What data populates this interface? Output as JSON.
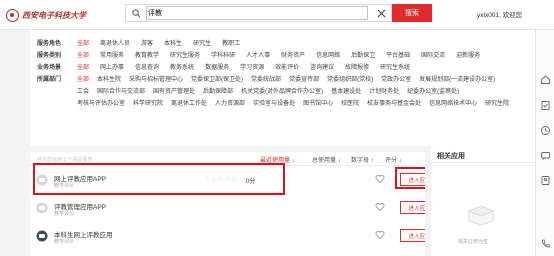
{
  "header": {
    "logo_text": "西安电子科技大学",
    "search_value": "评教",
    "search_button": "搜索",
    "user_greeting": "yxlx001, 欢迎您"
  },
  "filters": [
    {
      "label": "服务角色",
      "items": [
        "全部",
        "离退休人员",
        "游客",
        "本科生",
        "研究生",
        "教职工"
      ]
    },
    {
      "label": "服务类别",
      "items": [
        "全部",
        "常用服务",
        "教育教学",
        "研究生服务",
        "学科科研",
        "人才人事",
        "财务资产",
        "信息网络",
        "后勤保卫",
        "平台基础",
        "国际交流",
        "迎新服务"
      ]
    },
    {
      "label": "业务场景",
      "items": [
        "全部",
        "网上办事",
        "信息查询",
        "教务系统",
        "数据服务",
        "学习资源",
        "效能评价",
        "咨询建议",
        "故障报修",
        "研究生系统"
      ]
    },
    {
      "label": "所属部门",
      "items": [
        "全部",
        "本科生院",
        "采购与招标管理中心",
        "党委保卫部(保卫处)",
        "党委统战部",
        "党委宣传部",
        "党委组织部(党校)",
        "党政办公室",
        "发展规划部(一流建设办公室)",
        "工会",
        "国际合作与交流部",
        "国有资产管理处",
        "后勤保障部",
        "机关党委(对外品牌合作办公室)",
        "基本建设处",
        "计划财务处",
        "纪委办公室(监察处)",
        "考核与评估办公室",
        "科学研究院",
        "离退休工作处",
        "人力资源部",
        "实验室与设备处",
        "图书馆中心",
        "校医院",
        "校友事务与基金会处",
        "信息网络技术中心",
        "研究生院"
      ]
    }
  ],
  "list": {
    "hint": "共为您找到 3 个相关服务",
    "sort_recent": "最近使用量 ↓",
    "sort_total": "总使用量 ↓",
    "sort_count": "数字母 ↑",
    "sort_score": "评分 ↓",
    "enter_label": "进入应用",
    "rows": [
      {
        "name": "网上评教应用APP",
        "category": "教学评价",
        "score": "0分"
      },
      {
        "name": "评教管理应用APP",
        "category": "教学评价",
        "score": ""
      },
      {
        "name": "本科生网上评教应用",
        "category": "教学评价",
        "score": ""
      }
    ]
  },
  "related": {
    "title": "相关应用",
    "empty_text": "相关应用为空"
  },
  "colors": {
    "accent": "#e22c2c",
    "highlight_box": "#d9121f"
  }
}
